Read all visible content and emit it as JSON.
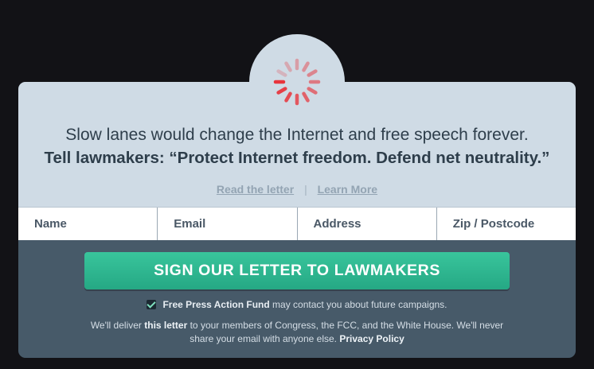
{
  "headline": "Slow lanes would change the Internet and free speech forever.",
  "subheadline": "Tell lawmakers: “Protect Internet freedom. Defend net neutrality.”",
  "links": {
    "read_letter": "Read the letter",
    "separator": "|",
    "learn_more": "Learn More"
  },
  "form": {
    "name_placeholder": "Name",
    "email_placeholder": "Email",
    "address_placeholder": "Address",
    "zip_placeholder": "Zip / Postcode"
  },
  "cta_label": "SIGN OUR LETTER TO LAWMAKERS",
  "optin": {
    "checked": true,
    "org": "Free Press Action Fund",
    "text": " may contact you about future campaigns."
  },
  "disclaimer": {
    "part1": "We'll deliver ",
    "bold": "this letter",
    "part2": " to your members of Congress, the FCC, and the White House. We'll never share your email with anyone else. ",
    "privacy_link": "Privacy Policy"
  },
  "colors": {
    "page_background": "#121216",
    "card_top": "#cfdbe5",
    "card_bottom": "#475a69",
    "cta": "#2db892",
    "spinner": "#e8343c"
  },
  "icons": {
    "spinner": "loading-spinner-icon",
    "checkbox": "checkmark-icon"
  }
}
